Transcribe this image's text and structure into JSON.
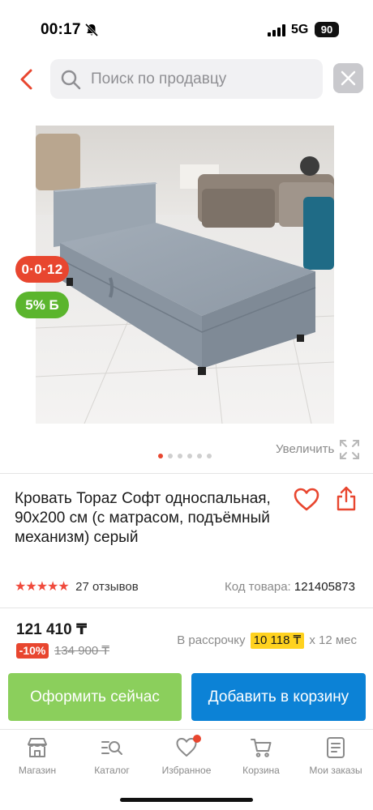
{
  "status_bar": {
    "time": "00:17",
    "network": "5G",
    "battery": "90"
  },
  "search": {
    "placeholder": "Поиск по продавцу",
    "value": ""
  },
  "badges": {
    "installment": "0·0·12",
    "bonus": "5% Б"
  },
  "gallery": {
    "total": 6,
    "active_index": 0,
    "zoom_label": "Увеличить"
  },
  "product": {
    "title": "Кровать Topaz Софт односпальная, 90x200 см (с матрасом, подъёмный механизм) серый",
    "rating": 5,
    "reviews": "27 отзывов",
    "sku_label": "Код товара:",
    "sku_value": "121405873"
  },
  "pricing": {
    "price": "121 410 ₸",
    "discount": "-10%",
    "old_price": "134 900 ₸",
    "installment_prefix": "В рассрочку",
    "installment_amount": "10 118 ₸",
    "installment_suffix": "x 12 мес"
  },
  "actions": {
    "buy_now": "Оформить сейчас",
    "add_to_cart": "Добавить в корзину"
  },
  "nav": {
    "items": [
      {
        "label": "Магазин",
        "icon": "store-icon"
      },
      {
        "label": "Каталог",
        "icon": "catalog-search-icon"
      },
      {
        "label": "Избранное",
        "icon": "heart-icon"
      },
      {
        "label": "Корзина",
        "icon": "cart-icon"
      },
      {
        "label": "Мои заказы",
        "icon": "orders-icon"
      }
    ]
  },
  "colors": {
    "accent_red": "#e8462f",
    "bonus_green": "#5bb52d",
    "buy_button": "#8bcf5c",
    "cart_button": "#0c82d6",
    "installment_highlight": "#ffd21f"
  }
}
